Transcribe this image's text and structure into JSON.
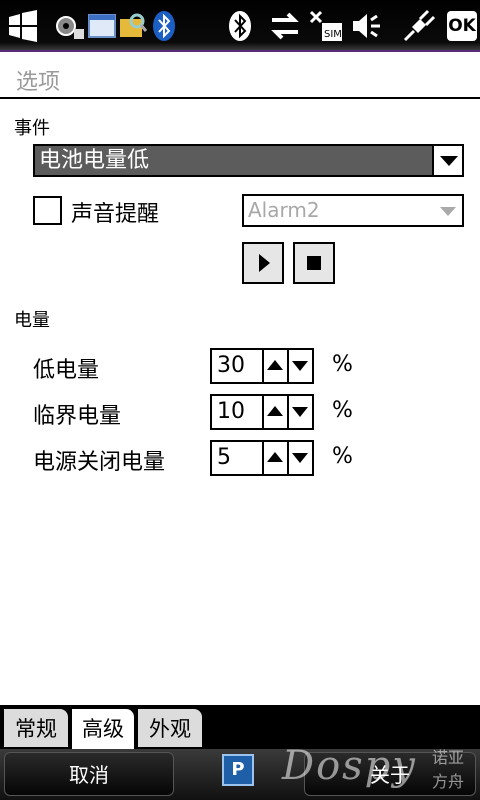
{
  "status_bar": {
    "icons": [
      "windows-start-icon",
      "app-settings-icon",
      "app-window-icon",
      "app-folder-search-icon",
      "bluetooth-icon",
      "bluetooth-icon",
      "sync-icon",
      "no-sim-icon",
      "volume-off-icon",
      "charging-plug-icon"
    ],
    "ok_label": "OK"
  },
  "title": "选项",
  "events": {
    "section_label": "事件",
    "event_selected": "电池电量低",
    "sound_reminder_label": "声音提醒",
    "sound_reminder_checked": false,
    "sound_selected": "Alarm2"
  },
  "power": {
    "section_label": "电量",
    "rows": [
      {
        "label": "低电量",
        "value": "30",
        "unit": "%"
      },
      {
        "label": "临界电量",
        "value": "10",
        "unit": "%"
      },
      {
        "label": "电源关闭电量",
        "value": "5",
        "unit": "%"
      }
    ]
  },
  "tabs": [
    {
      "label": "常规",
      "active": false
    },
    {
      "label": "高级",
      "active": true
    },
    {
      "label": "外观",
      "active": false
    }
  ],
  "softkeys": {
    "left": "取消",
    "right": "关于",
    "input_icon_letter": "P"
  },
  "watermark": {
    "brand": "Dospy",
    "line1": "诺亚",
    "line2": "方舟"
  },
  "colors": {
    "selected_dropdown_bg": "#5c5c5c",
    "status_bar_bg": "#000000",
    "title_text": "#9a9a9a"
  }
}
